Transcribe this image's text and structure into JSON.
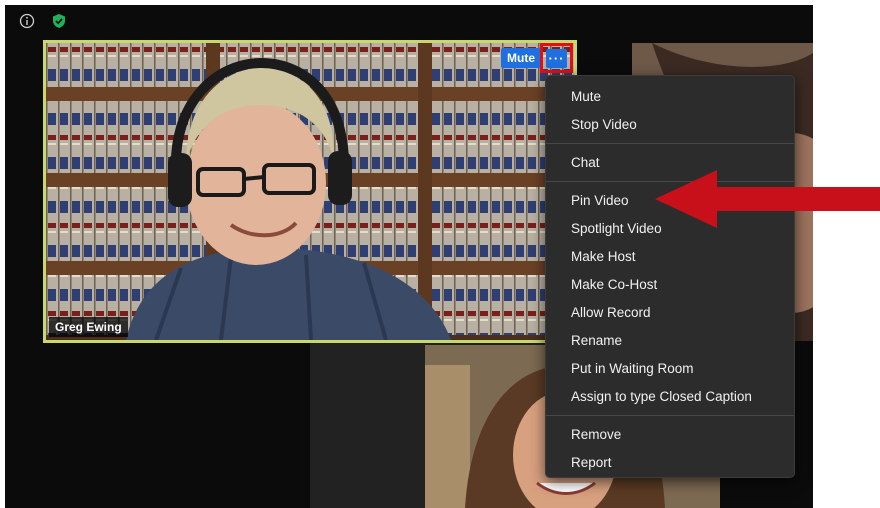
{
  "colors": {
    "highlight_border": "#e20f17",
    "active_speaker_border": "#c8d96a",
    "mute_button": "#1f6fe0",
    "menu_bg": "#2c2c2c",
    "arrow": "#c8101a"
  },
  "top_icons": [
    "info-icon",
    "shield-check-icon"
  ],
  "main_tile": {
    "participant_name": "Greg Ewing",
    "mute_label": "Mute",
    "more_label": "···"
  },
  "menu": {
    "groups": [
      [
        "Mute",
        "Stop Video"
      ],
      [
        "Chat"
      ],
      [
        "Pin Video",
        "Spotlight Video",
        "Make Host",
        "Make Co-Host",
        "Allow Record",
        "Rename",
        "Put in Waiting Room",
        "Assign to type Closed Caption"
      ],
      [
        "Remove",
        "Report"
      ]
    ]
  }
}
